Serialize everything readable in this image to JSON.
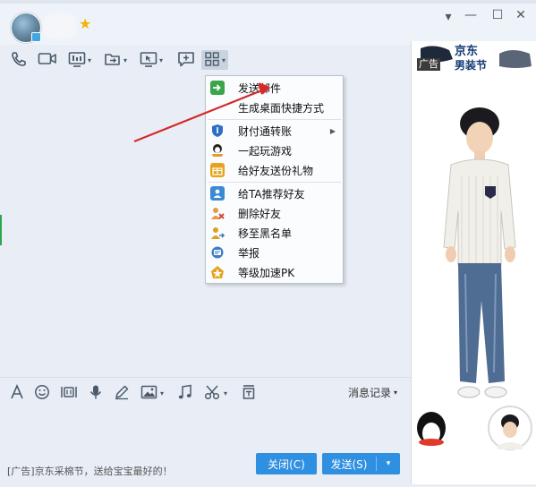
{
  "window": {
    "vip_symbol": "★",
    "controls": {
      "minimize": "▾",
      "restore": "—",
      "maximize": "☐",
      "close": "✕"
    }
  },
  "toolbar": {
    "icons": [
      "phone-icon",
      "video-call-icon",
      "screen-share-icon",
      "file-transfer-icon",
      "remote-assist-icon",
      "message-icon",
      "apps-grid-icon"
    ]
  },
  "ad_panel": {
    "tag": "广告",
    "brand": "京东",
    "slogan": "男装节"
  },
  "context_menu": {
    "items": [
      {
        "label": "发送邮件",
        "icon": "email-icon",
        "color": "#3aa54a"
      },
      {
        "label": "生成桌面快捷方式",
        "icon": "",
        "color": ""
      },
      {
        "label": "财付通转账",
        "icon": "shield-icon",
        "color": "#2d6fc4",
        "submenu": true
      },
      {
        "label": "一起玩游戏",
        "icon": "game-icon",
        "color": "#e39a2a"
      },
      {
        "label": "给好友送份礼物",
        "icon": "gift-icon",
        "color": "#e8a21c"
      },
      {
        "label": "给TA推荐好友",
        "icon": "recommend-friend-icon",
        "color": "#3b8ad6"
      },
      {
        "label": "删除好友",
        "icon": "delete-friend-icon",
        "color": "#d04a3a"
      },
      {
        "label": "移至黑名单",
        "icon": "blacklist-icon",
        "color": "#e0a020"
      },
      {
        "label": "举报",
        "icon": "report-icon",
        "color": "#3a7ec4"
      },
      {
        "label": "等级加速PK",
        "icon": "level-pk-icon",
        "color": "#e8a21c"
      }
    ],
    "submenu_arrow": "▶"
  },
  "input_toolbar": {
    "icons": [
      "font-icon",
      "emoji-icon",
      "gif-icon",
      "voice-icon",
      "pen-icon",
      "image-icon",
      "music-icon",
      "scissors-icon",
      "save-icon"
    ],
    "history_label": "消息记录"
  },
  "bottom": {
    "ad_text": "[广告]京东采棉节，送给宝宝最好的！",
    "close_button": "关闭(C)",
    "send_button": "发送(S)",
    "send_dropdown": "▾"
  },
  "colors": {
    "accent": "#2f8fe0",
    "annotation_arrow": "#d42a2a",
    "background": "#e9eef6"
  }
}
